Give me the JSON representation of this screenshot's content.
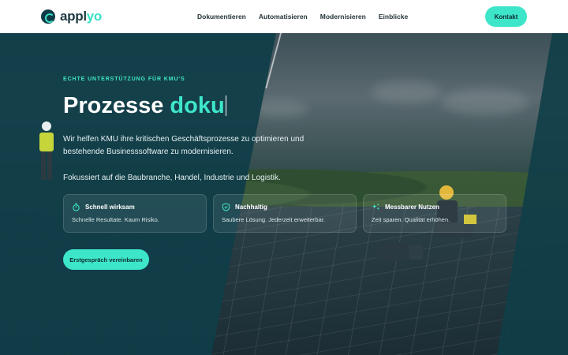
{
  "brand": {
    "name_main": "appl",
    "name_accent": "yo"
  },
  "nav": {
    "items": [
      "Dokumentieren",
      "Automatisieren",
      "Modernisieren",
      "Einblicke"
    ],
    "cta": "Kontakt"
  },
  "hero": {
    "eyebrow": "ECHTE UNTERSTÜTZUNG FÜR KMU'S",
    "headline_static": "Prozesse ",
    "headline_typed": "doku",
    "lead": "Wir helfen KMU ihre kritischen Geschäftsprozesse zu optimieren und bestehende Businesssoftware zu modernisieren.",
    "focus": "Fokussiert auf die Baubranche, Handel, Industrie und Logistik.",
    "cards": [
      {
        "icon": "stopwatch-icon",
        "title": "Schnell wirksam",
        "text": "Schnelle Resultate. Kaum Risiko."
      },
      {
        "icon": "shield-check-icon",
        "title": "Nachhaltig",
        "text": "Saubere Lösung. Jederzeit erweiterbar."
      },
      {
        "icon": "sparkles-icon",
        "title": "Messbarer Nutzen",
        "text": "Zeit sparen. Qualität erhöhen."
      }
    ],
    "cta": "Erstgespräch vereinbaren"
  },
  "colors": {
    "accent": "#3ee6c9",
    "dark": "#103e48",
    "text_dark": "#243438"
  }
}
